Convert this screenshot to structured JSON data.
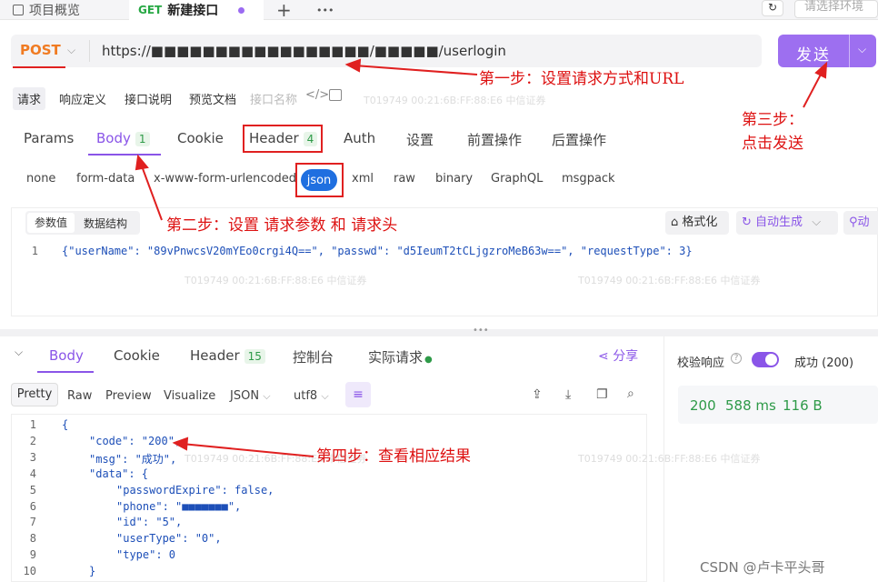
{
  "top_tabs": {
    "overview": "项目概览",
    "new_method": "GET",
    "new_label": "新建接口",
    "add": "+",
    "more": "•••",
    "env_placeholder": "请选择环境"
  },
  "request": {
    "method": "POST",
    "url": "https://■■■■■■■■■■■■■■■■■/■■■■■/userlogin",
    "send_label": "发送"
  },
  "sub_tabs": [
    "请求",
    "响应定义",
    "接口说明",
    "预览文档"
  ],
  "sub_name": "接口名称",
  "param_tabs": [
    {
      "label": "Params"
    },
    {
      "label": "Body",
      "count": "1"
    },
    {
      "label": "Cookie"
    },
    {
      "label": "Header",
      "count": "4"
    },
    {
      "label": "Auth"
    },
    {
      "label": "设置"
    },
    {
      "label": "前置操作"
    },
    {
      "label": "后置操作"
    }
  ],
  "body_types": [
    "none",
    "form-data",
    "x-www-form-urlencoded",
    "json",
    "xml",
    "raw",
    "binary",
    "GraphQL",
    "msgpack"
  ],
  "editor": {
    "seg_params": "参数值",
    "seg_schema": "数据结构",
    "format": "格式化",
    "autogen": "自动生成",
    "more": "动",
    "line": "1",
    "body_text": "{\"userName\": \"89vPnwcsV20mYEo0crgi4Q==\", \"passwd\": \"d5IeumT2tCLjgzroMeB63w==\", \"requestType\": 3}"
  },
  "response_tabs": [
    {
      "label": "Body"
    },
    {
      "label": "Cookie"
    },
    {
      "label": "Header",
      "count": "15"
    },
    {
      "label": "控制台"
    },
    {
      "label": "实际请求"
    }
  ],
  "share": "分享",
  "response_view": [
    "Pretty",
    "Raw",
    "Preview",
    "Visualize",
    "JSON",
    "utf8"
  ],
  "validate": {
    "label": "校验响应",
    "result": "成功 (200)",
    "status": "200",
    "time": "588 ms",
    "size": "116 B"
  },
  "response_lines": [
    "{",
    "\"code\": \"200\",",
    "\"msg\": \"成功\",",
    "\"data\": {",
    "\"passwordExpire\": false,",
    "\"phone\": \"■■■■■■■\",",
    "\"id\": \"5\",",
    "\"userType\": \"0\",",
    "\"type\": 0",
    "}"
  ],
  "annotations": {
    "step1": "第一步：设置请求方式和URL",
    "step2": "第二步：设置 请求参数 和 请求头",
    "step3a": "第三步：",
    "step3b": "点击发送",
    "step4": "第四步：查看相应结果"
  },
  "watermarks": [
    "T019749   00:21:6B:FF:88:E6   中信证券"
  ],
  "footer": "CSDN @卢卡平头哥"
}
